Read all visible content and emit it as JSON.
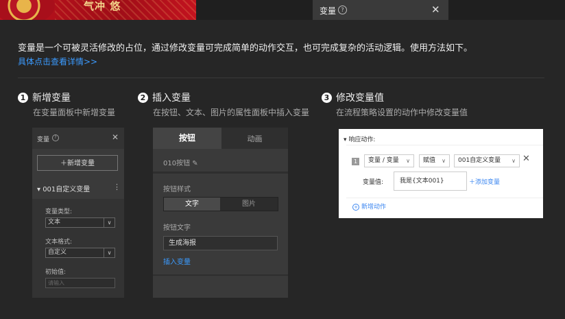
{
  "topbar": {
    "banner_chars": "气冲 悠",
    "tab_title": "变量",
    "help_glyph": "?",
    "close_glyph": "✕"
  },
  "intro": {
    "text": "变量是一个可被灵活修改的占位，通过修改变量可完成简单的动作交互，也可完成复杂的活动逻辑。使用方法如下。",
    "link": "具体点击查看详情>>"
  },
  "steps": [
    {
      "num": "1",
      "title": "新增变量",
      "desc": "在变量面板中新增变量"
    },
    {
      "num": "2",
      "title": "插入变量",
      "desc": "在按钮、文本、图片的属性面板中插入变量"
    },
    {
      "num": "3",
      "title": "修改变量值",
      "desc": "在流程策略设置的动作中修改变量值"
    }
  ],
  "panel1": {
    "header": "变量",
    "add_button": "＋新增变量",
    "variable_name": "▾ 001自定义变量",
    "menu_glyph": "⋮",
    "type_label": "变量类型:",
    "type_value": "文本",
    "format_label": "文本格式:",
    "format_value": "自定义",
    "init_label": "初始值:",
    "init_placeholder": "请输入",
    "arrow": "∨"
  },
  "panel2": {
    "tab_button": "按钮",
    "tab_anim": "动画",
    "element_name": "010按钮",
    "edit_glyph": "✎",
    "style_label": "按钮样式",
    "seg_text": "文字",
    "seg_image": "图片",
    "text_label": "按钮文字",
    "text_value": "生成海报",
    "insert_link": "插入变量"
  },
  "panel3": {
    "header": "▾ 响应动作:",
    "row_num": "1",
    "dd1": "变量 / 变量",
    "dd2": "赋值",
    "dd3": "001自定义变量",
    "chevron": "∨",
    "remove_glyph": "✕",
    "value_label": "变量值:",
    "value_text": "我是{文本001}",
    "add_var_link": "＋添加变量",
    "new_action": "新增动作",
    "plus_glyph": "+"
  },
  "colors": {
    "accent": "#3b9bff",
    "background": "#262626",
    "panel": "#3a3a3a"
  }
}
